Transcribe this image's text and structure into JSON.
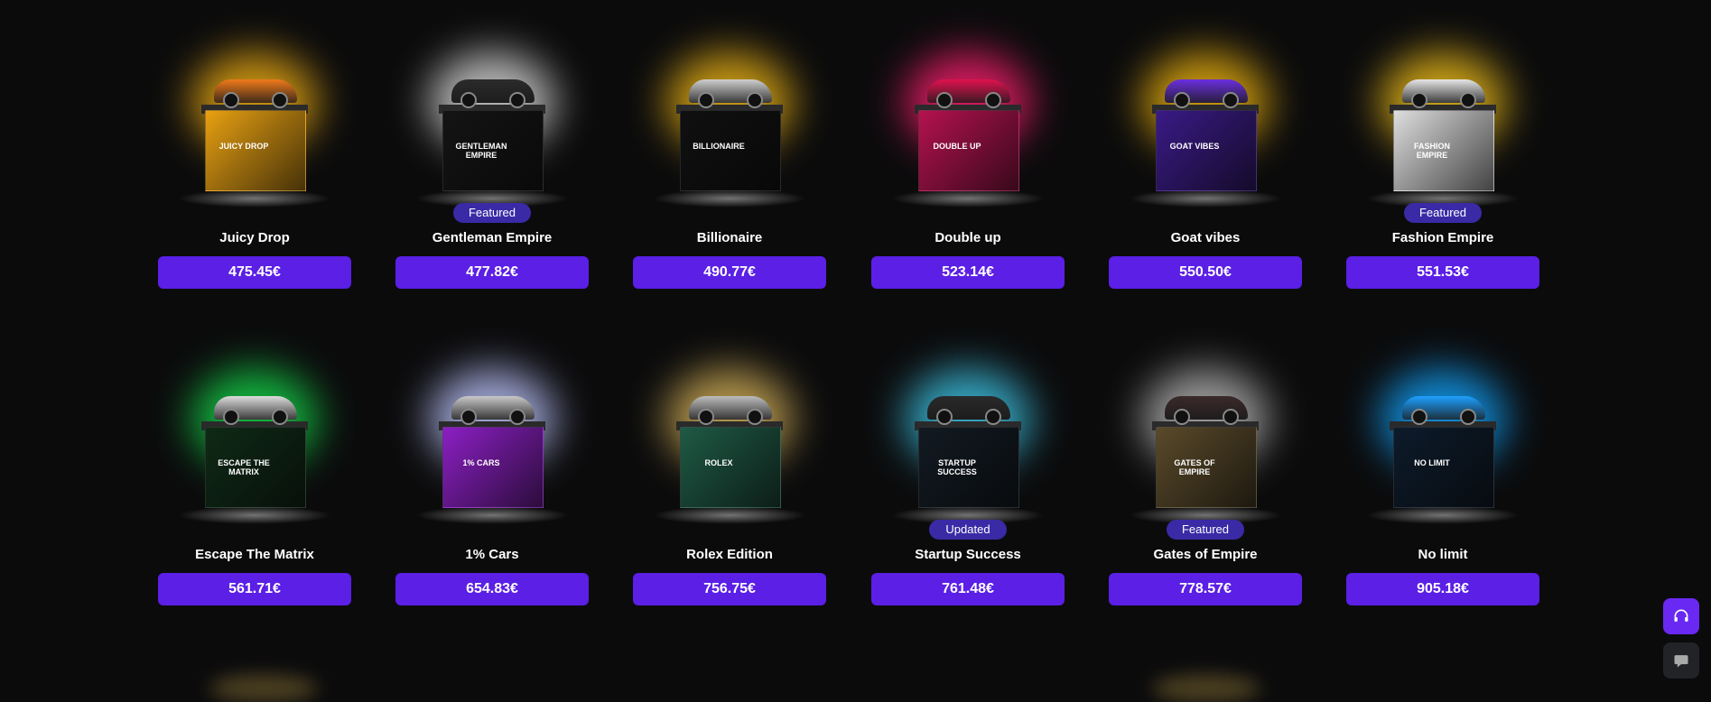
{
  "cases": [
    {
      "name": "Juicy Drop",
      "price": "475.45€",
      "badge": "",
      "label": "Juicy Drop",
      "glow": "#f2b014",
      "box": "#e8a112",
      "car": "#f07a1a"
    },
    {
      "name": "Gentleman Empire",
      "price": "477.82€",
      "badge": "Featured",
      "label": "Gentleman Empire",
      "glow": "#dcdcdc",
      "box": "#141414",
      "car": "#2b2b2b"
    },
    {
      "name": "Billionaire",
      "price": "490.77€",
      "badge": "",
      "label": "Billionaire",
      "glow": "#f0b716",
      "box": "#101010",
      "car": "#cfcfcf"
    },
    {
      "name": "Double up",
      "price": "523.14€",
      "badge": "",
      "label": "Double up",
      "glow": "#ff1f6f",
      "box": "#b4124f",
      "car": "#e0124f"
    },
    {
      "name": "Goat vibes",
      "price": "550.50€",
      "badge": "",
      "label": "Goat vibes",
      "glow": "#f1b60f",
      "box": "#3a1a86",
      "car": "#6b2fe0"
    },
    {
      "name": "Fashion Empire",
      "price": "551.53€",
      "badge": "Featured",
      "label": "Fashion Empire",
      "glow": "#f4c21a",
      "box": "#dedede",
      "car": "#e6e6e6"
    },
    {
      "name": "Escape The Matrix",
      "price": "561.71€",
      "badge": "",
      "label": "Escape The Matrix",
      "glow": "#15d94a",
      "box": "#0f2a16",
      "car": "#dddddd"
    },
    {
      "name": "1% Cars",
      "price": "654.83€",
      "badge": "",
      "label": "1% Cars",
      "glow": "#bfc7ff",
      "box": "#8c1fc4",
      "car": "#c9c9c9"
    },
    {
      "name": "Rolex Edition",
      "price": "756.75€",
      "badge": "",
      "label": "Rolex",
      "glow": "#d8b45a",
      "box": "#1f5a45",
      "car": "#bdbdbd"
    },
    {
      "name": "Startup Success",
      "price": "761.48€",
      "badge": "Updated",
      "label": "Startup Success",
      "glow": "#3ec7e8",
      "box": "#121a22",
      "car": "#2a2a2a"
    },
    {
      "name": "Gates of Empire",
      "price": "778.57€",
      "badge": "Featured",
      "label": "Gates of Empire",
      "glow": "#b9b9b9",
      "box": "#5a4a2a",
      "car": "#3b2a2a"
    },
    {
      "name": "No limit",
      "price": "905.18€",
      "badge": "",
      "label": "No Limit",
      "glow": "#12a6ff",
      "box": "#0d1b2b",
      "car": "#1ea0ff"
    }
  ],
  "support": {
    "icon": "headset-icon"
  },
  "chat": {
    "icon": "chat-icon"
  }
}
